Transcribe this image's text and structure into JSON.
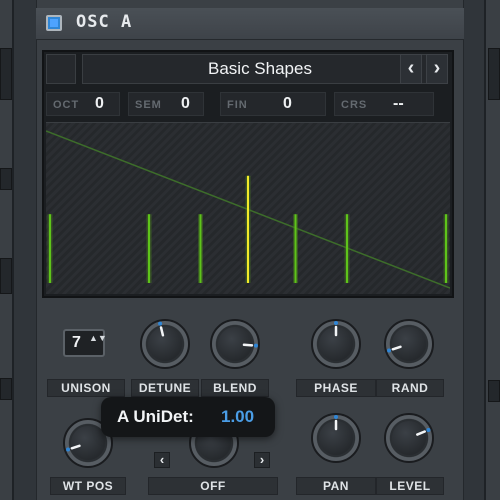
{
  "oscillator": {
    "title": "OSC A",
    "enabled": true,
    "accent_color": "#2f86d6"
  },
  "wavetable": {
    "name": "Basic Shapes",
    "prev_label": "‹",
    "next_label": "›",
    "params": [
      {
        "label": "OCT",
        "value": "0"
      },
      {
        "label": "SEM",
        "value": "0"
      },
      {
        "label": "FIN",
        "value": "0"
      },
      {
        "label": "CRS",
        "value": "--"
      }
    ],
    "display": {
      "spikes": [
        {
          "position": 0.0,
          "height": 0.43,
          "color": "#5ec41a"
        },
        {
          "position": 0.25,
          "height": 0.43,
          "color": "#5ec41a"
        },
        {
          "position": 0.38,
          "height": 0.43,
          "color": "#5ec41a"
        },
        {
          "position": 0.5,
          "height": 0.67,
          "color": "#f3ea2a"
        },
        {
          "position": 0.62,
          "height": 0.43,
          "color": "#5ec41a"
        },
        {
          "position": 0.75,
          "height": 0.43,
          "color": "#5ec41a"
        },
        {
          "position": 1.0,
          "height": 0.43,
          "color": "#5ec41a"
        }
      ],
      "ramp_color": "#3d6d2a",
      "spike_glow": "#4a7d1e"
    }
  },
  "controls": {
    "unison": {
      "label": "UNISON",
      "value": "7",
      "arrows": "▲▼"
    },
    "knobs": [
      {
        "name": "detune",
        "label": "DETUNE",
        "value": 0.45
      },
      {
        "name": "blend",
        "label": "BLEND",
        "value": 0.85
      },
      {
        "name": "phase",
        "label": "PHASE",
        "value": 0.5
      },
      {
        "name": "rand",
        "label": "RAND",
        "value": 0.1
      },
      {
        "name": "wt-pos",
        "label": "WT POS",
        "value": 0.1
      },
      {
        "name": "pan",
        "label": "PAN",
        "value": 0.5
      },
      {
        "name": "level",
        "label": "LEVEL",
        "value": 0.75
      }
    ],
    "warp": {
      "label": "OFF",
      "prev": "‹",
      "next": "›"
    }
  },
  "tooltip": {
    "label": "A UniDet:",
    "value": "1.00"
  }
}
